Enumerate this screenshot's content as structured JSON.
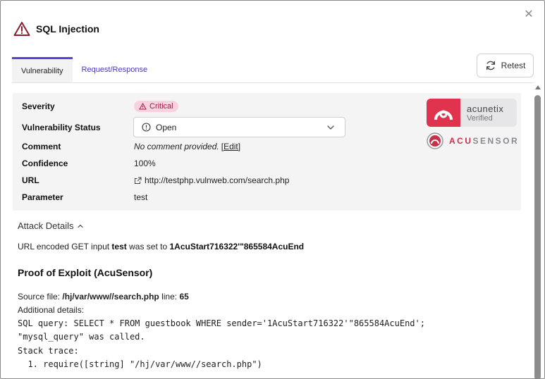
{
  "dialog": {
    "title": "SQL Injection"
  },
  "tabs": [
    {
      "label": "Vulnerability"
    },
    {
      "label": "Request/Response"
    }
  ],
  "retest_label": "Retest",
  "details": {
    "severity": {
      "label": "Severity",
      "value": "Critical"
    },
    "status": {
      "label": "Vulnerability Status",
      "value": "Open"
    },
    "comment": {
      "label": "Comment",
      "value": "No comment provided.",
      "edit_label": "[Edit]"
    },
    "confidence": {
      "label": "Confidence",
      "value": "100%"
    },
    "url": {
      "label": "URL",
      "value": "http://testphp.vulnweb.com/search.php"
    },
    "parameter": {
      "label": "Parameter",
      "value": "test"
    }
  },
  "logos": {
    "acunetix_brand": "acunetix",
    "acunetix_sub": "Verified",
    "acusensor_acu": "ACU",
    "acusensor_sensor": "SENSOR"
  },
  "attack": {
    "header": "Attack Details",
    "prefix": "URL encoded GET input",
    "param": "test",
    "middle": "was set to",
    "payload": "1AcuStart716322'\"865584AcuEnd"
  },
  "proof": {
    "title": "Proof of Exploit (AcuSensor)",
    "source_prefix": "Source file:",
    "source_file": "/hj/var/www//search.php",
    "line_label": "line:",
    "line_number": "65",
    "additional": "Additional details:",
    "sql_query": "SQL query: SELECT * FROM guestbook WHERE sender='1AcuStart716322'\"865584AcuEnd';",
    "called": "\"mysql_query\" was called.",
    "stack_label": "Stack trace:",
    "stack_item": "  1. require([string] \"/hj/var/www//search.php\")"
  },
  "colors": {
    "accent": "#5b3fd6",
    "critical_bg": "#f6d3df",
    "critical_text": "#a11b44",
    "acunetix_red": "#e0334d"
  }
}
